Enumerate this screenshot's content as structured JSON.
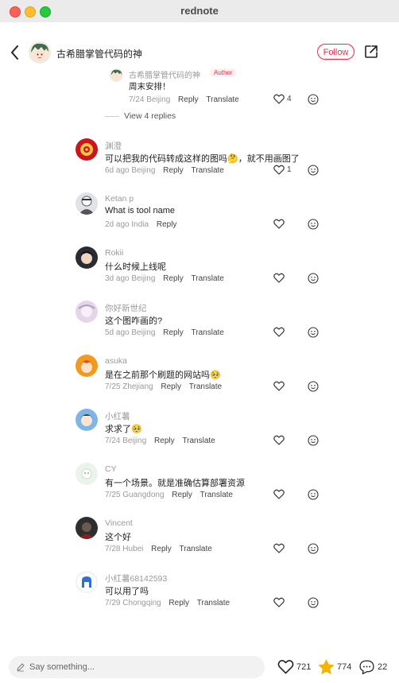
{
  "window": {
    "title": "rednote"
  },
  "header": {
    "author_name": "古希腊掌管代码的神",
    "follow_label": "Follow"
  },
  "reply": {
    "name": "古希腊掌管代码的神",
    "author_tag": "Author",
    "text": "周末安排！",
    "time": "7/24 Beijing",
    "reply_label": "Reply",
    "translate_label": "Translate",
    "likes": "4"
  },
  "view_replies": "View 4 replies",
  "comments": [
    {
      "name": "渊澄",
      "text": "可以把我的代码转成这样的图吗🤔，就不用画图了",
      "time": "6d ago Beijing",
      "reply": "Reply",
      "translate": "Translate",
      "likes": "1"
    },
    {
      "name": "Ketan p",
      "text": "What is tool name",
      "time": "2d ago India",
      "reply": "Reply",
      "translate": "",
      "likes": ""
    },
    {
      "name": "Rokii",
      "text": "什么时候上线呢",
      "time": "3d ago Beijing",
      "reply": "Reply",
      "translate": "Translate",
      "likes": ""
    },
    {
      "name": "你好新世纪",
      "text": "这个图咋画的?",
      "time": "5d ago Beijing",
      "reply": "Reply",
      "translate": "Translate",
      "likes": ""
    },
    {
      "name": "asuka",
      "text": "是在之前那个刷题的网站吗🥺",
      "time": "7/25 Zhejiang",
      "reply": "Reply",
      "translate": "Translate",
      "likes": ""
    },
    {
      "name": "小红薯",
      "text": "求求了🥺",
      "time": "7/24 Beijing",
      "reply": "Reply",
      "translate": "Translate",
      "likes": ""
    },
    {
      "name": "CY",
      "text": "有一个场景。就是准确估算部署资源",
      "time": "7/25 Guangdong",
      "reply": "Reply",
      "translate": "Translate",
      "likes": ""
    },
    {
      "name": "Vincent",
      "text": "这个好",
      "time": "7/28 Hubei",
      "reply": "Reply",
      "translate": "Translate",
      "likes": ""
    },
    {
      "name": "小红薯68142593",
      "text": "可以用了吗",
      "time": "7/29 Chongqing",
      "reply": "Reply",
      "translate": "Translate",
      "likes": ""
    }
  ],
  "bottom": {
    "placeholder": "Say something...",
    "likes": "721",
    "stars": "774",
    "comments": "22"
  },
  "colors": {
    "accent": "#ff2442",
    "star": "#f5b400"
  }
}
